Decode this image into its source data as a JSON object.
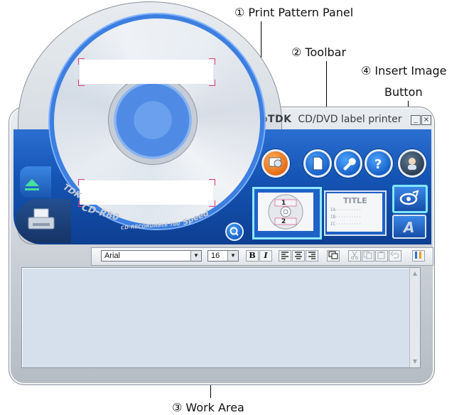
{
  "annotations": {
    "print_pattern_panel": "① Print Pattern Panel",
    "toolbar": "② Toolbar",
    "work_area": "③ Work Area",
    "insert_image_line1": "④ Insert Image",
    "insert_image_line2": "Button"
  },
  "window": {
    "brand": "TDK",
    "title": "CD/DVD label printer",
    "minimize_label": "_",
    "close_label": "×"
  },
  "cd": {
    "brand_text": "TDK",
    "model_text": "CD-R80",
    "sub_text": "CD-RECORDABLE 700",
    "speed_text": "Speed"
  },
  "print_pattern": {
    "top_label": "1",
    "bottom_label": "2"
  },
  "title_panel": {
    "title": "TITLE",
    "lines": [
      "IA··········",
      "IB··········",
      "IC··········"
    ]
  },
  "toolbar": {
    "font_value": "Arial",
    "size_value": "16",
    "bold_label": "B",
    "italic_label": "I"
  },
  "colors": {
    "body_blue": "#1555b5",
    "highlight_cyan": "#7fe7ff",
    "work_area": "#d5e0ec"
  },
  "icons": [
    "eject-icon",
    "printer-icon",
    "layout-icon",
    "new-document-icon",
    "settings-wrench-icon",
    "help-icon",
    "user-icon",
    "zoom-icon",
    "insert-image-icon",
    "text-insert-icon"
  ]
}
